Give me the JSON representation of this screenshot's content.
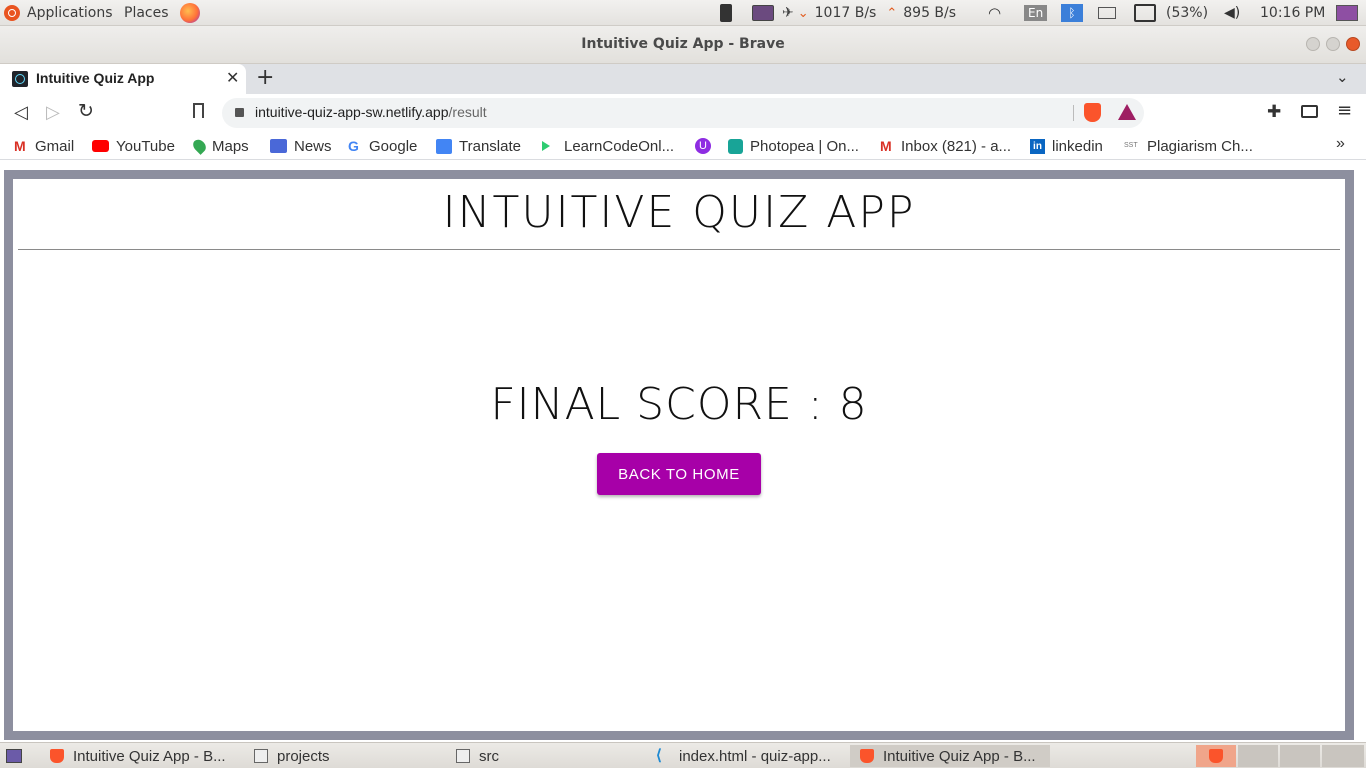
{
  "top_panel": {
    "menu_applications": "Applications",
    "menu_places": "Places",
    "net_down": "1017 B/s",
    "net_up": "895 B/s",
    "keyboard_layout": "En",
    "battery": "(53%)",
    "clock": "10:16 PM"
  },
  "window": {
    "title": "Intuitive Quiz App - Brave"
  },
  "tabs": [
    {
      "label": "Intuitive Quiz App"
    }
  ],
  "toolbar": {
    "url_host": "intuitive-quiz-app-sw.netlify.app",
    "url_path": "/result"
  },
  "bookmarks": [
    {
      "label": "Gmail",
      "icon": "gmail-icon"
    },
    {
      "label": "YouTube",
      "icon": "youtube-icon"
    },
    {
      "label": "Maps",
      "icon": "maps-icon"
    },
    {
      "label": "News",
      "icon": "news-icon"
    },
    {
      "label": "Google",
      "icon": "google-icon"
    },
    {
      "label": "Translate",
      "icon": "translate-icon"
    },
    {
      "label": "LearnCodeOnl...",
      "icon": "play-icon"
    },
    {
      "label": "",
      "icon": "u-icon"
    },
    {
      "label": "Photopea | On...",
      "icon": "photopea-icon"
    },
    {
      "label": "Inbox (821) - a...",
      "icon": "gmail-icon"
    },
    {
      "label": "linkedin",
      "icon": "linkedin-icon"
    },
    {
      "label": "Plagiarism Ch...",
      "icon": "sst-icon"
    }
  ],
  "app": {
    "title": "INTUITIVE QUIZ APP",
    "final_score": "FINAL SCORE : 8",
    "back_button": "BACK TO HOME"
  },
  "taskbar": [
    {
      "label": "Intuitive Quiz App - B..."
    },
    {
      "label": "projects"
    },
    {
      "label": "src"
    },
    {
      "label": "index.html - quiz-app..."
    },
    {
      "label": "Intuitive Quiz App - B..."
    }
  ],
  "colors": {
    "accent_button": "#a700a8",
    "frame_border": "#8d8f9f",
    "brave_orange": "#fb542b"
  }
}
